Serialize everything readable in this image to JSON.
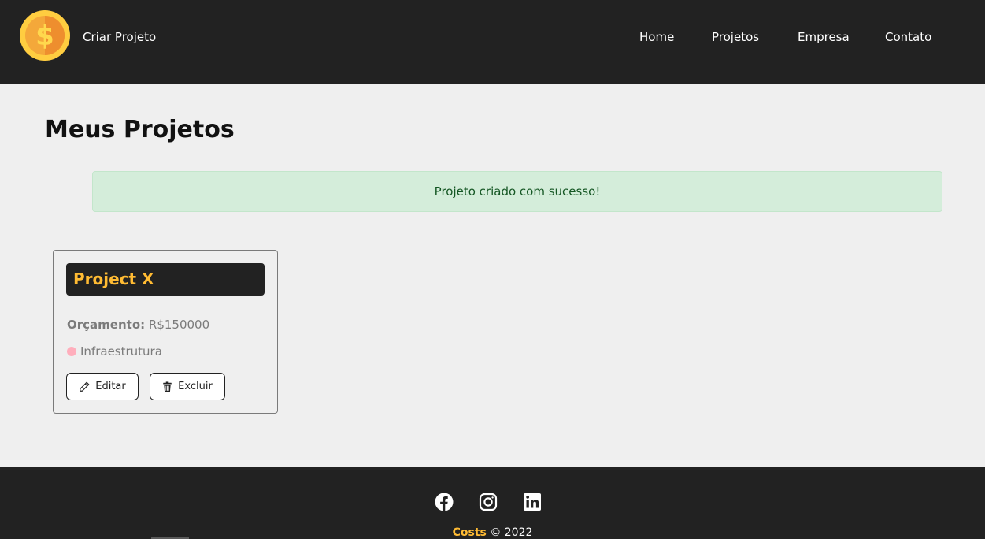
{
  "navbar": {
    "brand_label": "Criar Projeto",
    "logo_icon": "coin-dollar-icon",
    "items": [
      {
        "label": "Home"
      },
      {
        "label": "Projetos"
      },
      {
        "label": "Empresa"
      },
      {
        "label": "Contato"
      }
    ]
  },
  "main": {
    "title": "Meus Projetos",
    "alert_message": "Projeto criado com sucesso!",
    "projects": [
      {
        "name": "Project X",
        "budget_label": "Orçamento:",
        "budget_value": "R$150000",
        "category": "Infraestrutura",
        "category_color": "#ffaebc",
        "edit_label": "Editar",
        "delete_label": "Excluir"
      }
    ]
  },
  "footer": {
    "social_icons": [
      "facebook-icon",
      "instagram-icon",
      "linkedin-icon"
    ],
    "brand": "Costs",
    "copyright": "© 2022"
  },
  "colors": {
    "navbar_bg": "#222222",
    "accent": "#ffbb33",
    "page_bg": "#efefef",
    "alert_bg": "#d4edda",
    "alert_text": "#155724"
  }
}
